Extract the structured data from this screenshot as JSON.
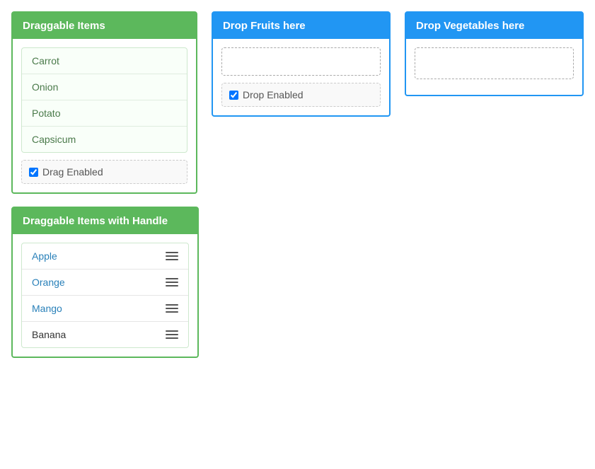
{
  "draggable_panel": {
    "title": "Draggable Items",
    "items": [
      {
        "label": "Carrot"
      },
      {
        "label": "Onion"
      },
      {
        "label": "Potato"
      },
      {
        "label": "Capsicum"
      }
    ],
    "checkbox_label": "Drag Enabled",
    "checkbox_checked": true
  },
  "fruits_panel": {
    "title": "Drop Fruits here",
    "checkbox_label": "Drop Enabled",
    "checkbox_checked": true
  },
  "vegetables_panel": {
    "title": "Drop Vegetables here"
  },
  "handle_panel": {
    "title": "Draggable Items with Handle",
    "items": [
      {
        "label": "Apple"
      },
      {
        "label": "Orange"
      },
      {
        "label": "Mango"
      },
      {
        "label": "Banana"
      }
    ]
  }
}
